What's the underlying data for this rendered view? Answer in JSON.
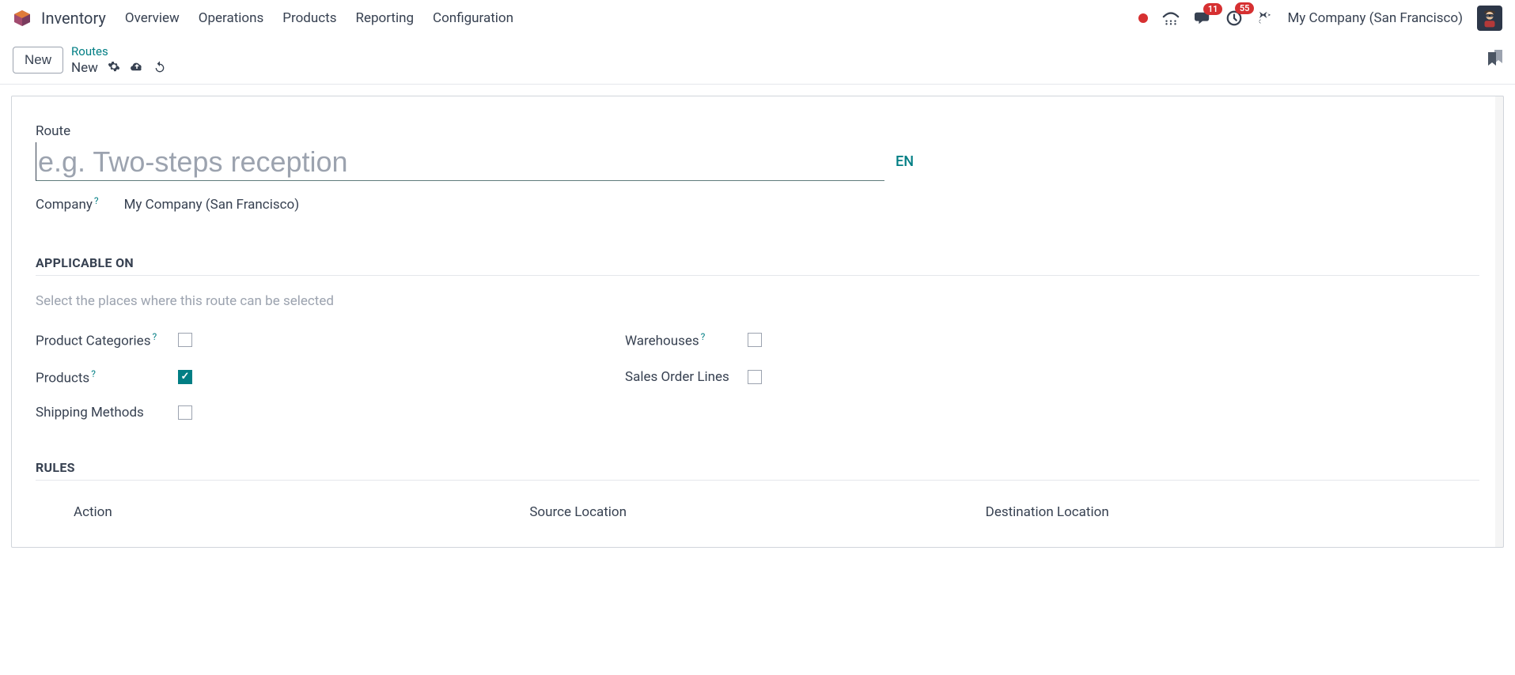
{
  "nav": {
    "app_title": "Inventory",
    "items": [
      "Overview",
      "Operations",
      "Products",
      "Reporting",
      "Configuration"
    ],
    "messages_badge": "11",
    "activities_badge": "55",
    "company": "My Company (San Francisco)"
  },
  "actionbar": {
    "new_button": "New",
    "breadcrumb_parent": "Routes",
    "breadcrumb_current": "New"
  },
  "form": {
    "route_label": "Route",
    "route_placeholder": "e.g. Two-steps reception",
    "lang": "EN",
    "company_label": "Company",
    "company_value": "My Company (San Francisco)",
    "help_marker": "?",
    "applicable": {
      "title": "APPLICABLE ON",
      "hint": "Select the places where this route can be selected",
      "product_categories": "Product Categories",
      "products": "Products",
      "shipping_methods": "Shipping Methods",
      "warehouses": "Warehouses",
      "sales_order_lines": "Sales Order Lines"
    },
    "rules": {
      "title": "RULES",
      "col_action": "Action",
      "col_source": "Source Location",
      "col_dest": "Destination Location"
    }
  }
}
